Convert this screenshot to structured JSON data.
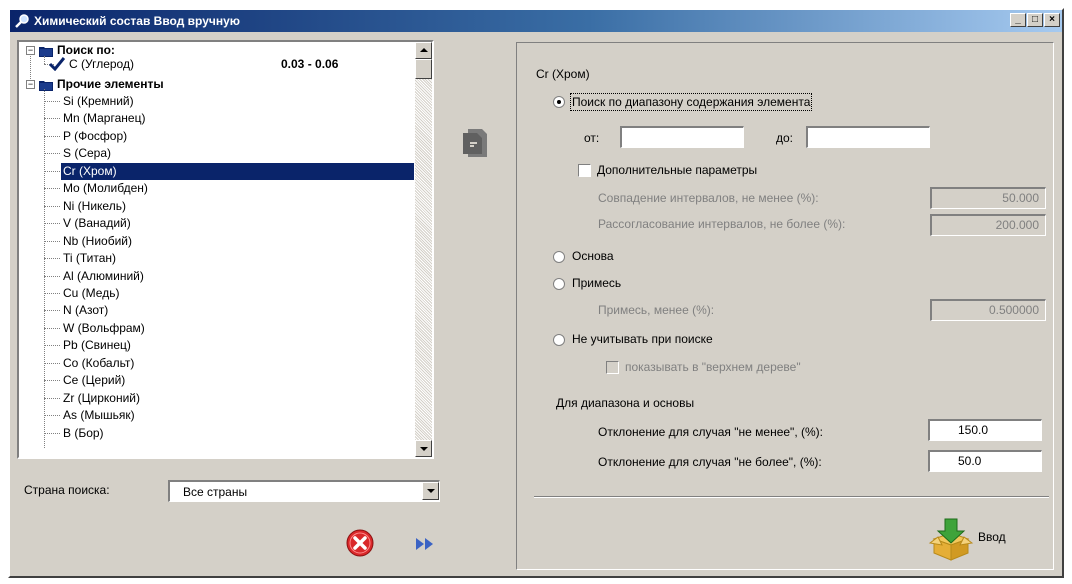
{
  "window": {
    "title": "Химический состав Ввод вручную",
    "min_label": "_",
    "max_label": "□",
    "close_label": "×"
  },
  "tree": {
    "search_by_label": "Поиск по:",
    "searched": [
      {
        "label": "C (Углерод)",
        "range": "0.03 - 0.06"
      }
    ],
    "other_label": "Прочие элементы",
    "elements": [
      "Si (Кремний)",
      "Mn (Марганец)",
      "P (Фосфор)",
      "S (Сера)",
      "Cr (Хром)",
      "Mo (Молибден)",
      "Ni (Никель)",
      "V (Ванадий)",
      "Nb (Ниобий)",
      "Ti (Титан)",
      "Al (Алюминий)",
      "Cu (Медь)",
      "N (Азот)",
      "W (Вольфрам)",
      "Pb (Свинец)",
      "Co (Кобальт)",
      "Ce (Церий)",
      "Zr (Цирконий)",
      "As (Мышьяк)",
      "B (Бор)"
    ],
    "selected": "Cr (Хром)"
  },
  "country": {
    "label": "Страна поиска:",
    "value": "Все страны"
  },
  "panel": {
    "element_title": "Cr (Хром)",
    "range_search_label": "Поиск по диапазону содержания элемента",
    "from_label": "от:",
    "to_label": "до:",
    "from_value": "",
    "to_value": "",
    "extra_params_label": "Дополнительные параметры",
    "overlap_label": "Совпадение интервалов, не менее (%):",
    "overlap_value": "50.000",
    "mismatch_label": "Рассогласование интервалов, не более (%):",
    "mismatch_value": "200.000",
    "base_label": "Основа",
    "impurity_label": "Примесь",
    "impurity_less_label": "Примесь, менее (%):",
    "impurity_value": "0.500000",
    "ignore_label": "Не учитывать при поиске",
    "show_top_tree_label": "показывать в \"верхнем дереве\"",
    "range_base_heading": "Для диапазона и основы",
    "dev_not_less_label": "Отклонение для случая \"не менее\", (%):",
    "dev_not_less_value": "150.0",
    "dev_not_more_label": "Отклонение для случая \"не более\", (%):",
    "dev_not_more_value": "50.0",
    "enter_label": "Ввод"
  }
}
